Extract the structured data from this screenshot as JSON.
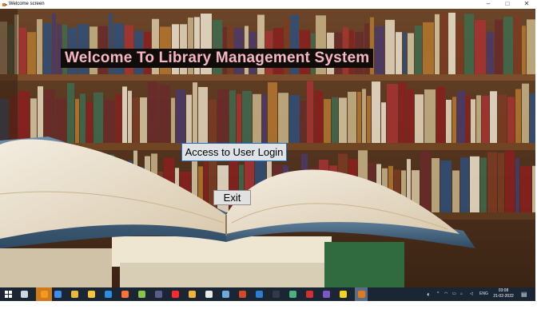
{
  "window": {
    "title": "Welcome screen",
    "minimize_glyph": "–",
    "maximize_glyph": "□",
    "close_glyph": "✕"
  },
  "main": {
    "heading": "Welcome To Library Management System",
    "login_button": "Access to User Login",
    "exit_button": "Exit"
  },
  "colors": {
    "heading_text": "#f6b6c2",
    "heading_bg": "#0f0c0a",
    "button_border": "#1d73c6",
    "taskbar": "#1b2635"
  },
  "taskbar": {
    "start_icon": "windows-start-icon",
    "pinned_icons": [
      "task-view-icon",
      "chrome-icon",
      "mail-icon",
      "chrome-alt-icon",
      "file-explorer-icon",
      "vscode-icon",
      "firefox-icon",
      "notepad-icon",
      "obs-icon",
      "youtube-icon",
      "chrome-profile-icon",
      "file-icon",
      "network-icon",
      "powerpoint-icon",
      "store-icon",
      "terminal-icon",
      "sourcetree-icon",
      "acrobat-icon",
      "visual-studio-icon",
      "sticky-notes-icon",
      "java-app-icon"
    ],
    "tray": {
      "language": "ENG",
      "time": "03:08",
      "date": "21-02-2022"
    }
  }
}
